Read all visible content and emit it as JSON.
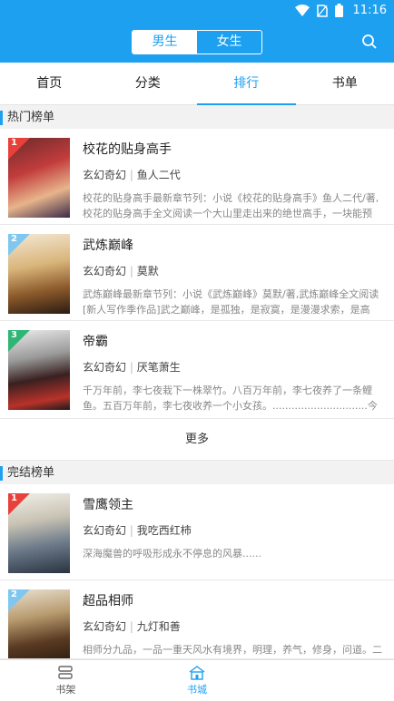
{
  "status": {
    "time": "11:16"
  },
  "header": {
    "gender_options": [
      {
        "label": "男生",
        "active": true
      },
      {
        "label": "女生",
        "active": false
      }
    ]
  },
  "tabs": [
    {
      "label": "首页"
    },
    {
      "label": "分类"
    },
    {
      "label": "排行",
      "active": true
    },
    {
      "label": "书单"
    }
  ],
  "sections": {
    "hot": {
      "title": "热门榜单"
    },
    "finished": {
      "title": "完结榜单"
    }
  },
  "hot_books": [
    {
      "rank": "1",
      "title": "校花的贴身高手",
      "genre": "玄幻奇幻",
      "author": "鱼人二代",
      "desc": "校花的贴身高手最新章节列：小说《校花的贴身高手》鱼人二代/著,校花的贴身高手全文阅读一个大山里走出来的绝世高手，一块能预知..."
    },
    {
      "rank": "2",
      "title": "武炼巅峰",
      "genre": "玄幻奇幻",
      "author": "莫默",
      "desc": "武炼巅峰最新章节列：小说《武炼巅峰》莫默/著,武炼巅峰全文阅读[新人写作季作品]武之巅峰，是孤独，是寂寞，是漫漫求索，是高处..."
    },
    {
      "rank": "3",
      "title": "帝霸",
      "genre": "玄幻奇幻",
      "author": "厌笔萧生",
      "desc": "千万年前，李七夜栽下一株翠竹。八百万年前，李七夜养了一条鲤鱼。五百万年前，李七夜收养一个小女孩。..............................今天，李..."
    }
  ],
  "more_label": "更多",
  "finished_books": [
    {
      "rank": "1",
      "title": "雪鹰领主",
      "genre": "玄幻奇幻",
      "author": "我吃西红柿",
      "desc": "深海魔兽的呼吸形成永不停息的风暴......"
    },
    {
      "rank": "2",
      "title": "超品相师",
      "genre": "玄幻奇幻",
      "author": "九灯和善",
      "desc": "相师分九品，一品一重天风水有境界，明理，养气，修身，问道。二十一世纪的一位普通青年偶获诸葛亮生前的玄学传承，从此混迹都市..."
    }
  ],
  "bottom_nav": [
    {
      "label": "书架",
      "icon": "bookshelf-icon"
    },
    {
      "label": "书城",
      "icon": "bookstore-icon",
      "active": true
    }
  ],
  "colors": {
    "accent": "#1ea0f0",
    "rank1": "#e8403a",
    "rank2": "#7fc7f0",
    "rank3": "#2fb574"
  }
}
